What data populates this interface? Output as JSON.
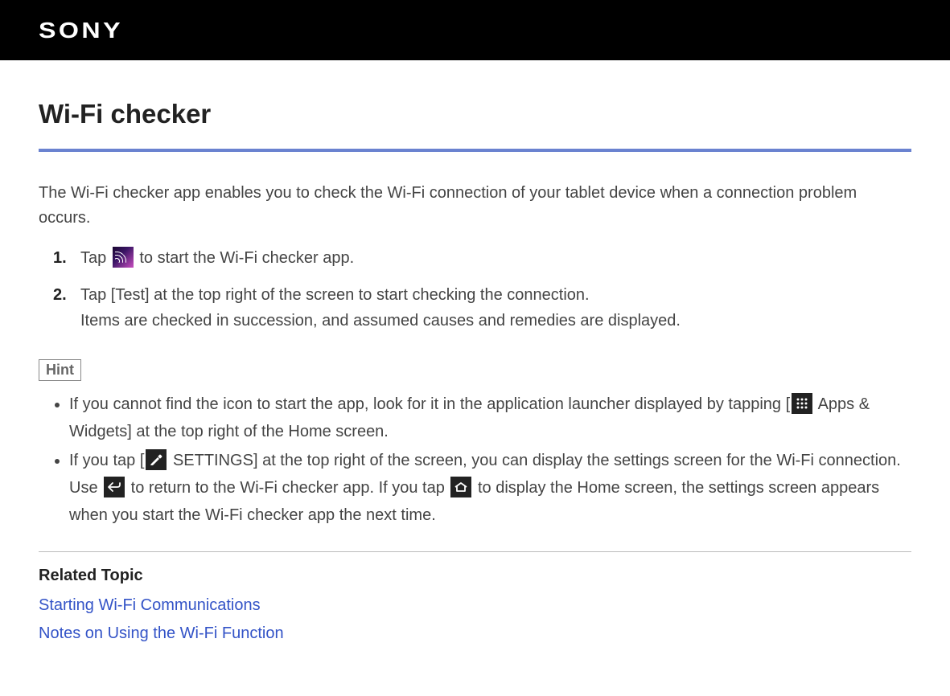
{
  "brand": "SONY",
  "page": {
    "title": "Wi-Fi checker",
    "intro": "The Wi-Fi checker app enables you to check the Wi-Fi connection of your tablet device when a connection problem occurs.",
    "steps": [
      {
        "num": "1.",
        "before_icon": "Tap ",
        "after_icon": " to start the Wi-Fi checker app."
      },
      {
        "num": "2.",
        "line1": "Tap [Test] at the top right of the screen to start checking the connection.",
        "line2": "Items are checked in succession, and assumed causes and remedies are displayed."
      }
    ],
    "hint_label": "Hint",
    "hints": [
      {
        "p1": "If you cannot find the icon to start the app, look for it in the application launcher displayed by tapping [",
        "p2": " Apps & Widgets] at the top right of the Home screen."
      },
      {
        "p1": "If you tap [",
        "p2": " SETTINGS] at the top right of the screen, you can display the settings screen for the Wi-Fi connection. Use ",
        "p3": " to return to the Wi-Fi checker app. If you tap ",
        "p4": " to display the Home screen, the settings screen appears when you start the Wi-Fi checker app the next time."
      }
    ],
    "related_heading": "Related Topic",
    "related_links": [
      "Starting Wi-Fi Communications",
      "Notes on Using the Wi-Fi Function"
    ]
  }
}
